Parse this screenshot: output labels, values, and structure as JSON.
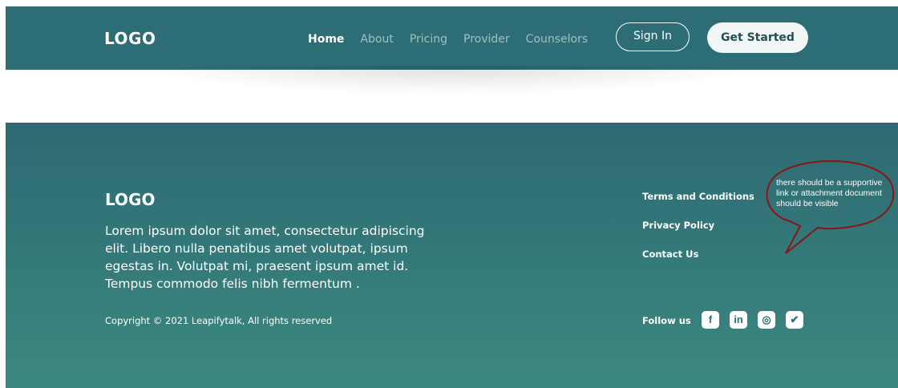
{
  "header": {
    "logo": "LOGO",
    "nav": [
      {
        "label": "Home"
      },
      {
        "label": "About"
      },
      {
        "label": "Pricing"
      },
      {
        "label": "Provider"
      },
      {
        "label": "Counselors"
      }
    ],
    "sign_in": "Sign In",
    "get_started": "Get Started"
  },
  "footer": {
    "logo": "LOGO",
    "description": "Lorem ipsum dolor sit amet, consectetur adipiscing elit. Libero nulla penatibus amet volutpat, ipsum egestas in. Volutpat mi, praesent ipsum amet id. Tempus commodo felis nibh fermentum .",
    "copyright": "Copyright © 2021 Leapifytalk, All rights reserved",
    "links": [
      {
        "label": "Terms and Conditions"
      },
      {
        "label": "Privacy Policy"
      },
      {
        "label": "Contact Us"
      }
    ],
    "follow_label": "Follow us",
    "social": [
      {
        "icon": "facebook-icon",
        "glyph": "f"
      },
      {
        "icon": "linkedin-icon",
        "glyph": "in"
      },
      {
        "icon": "instagram-icon",
        "glyph": "◎"
      },
      {
        "icon": "twitter-icon",
        "glyph": "✔"
      }
    ]
  },
  "annotation": {
    "text": "there should be a supportive link or attachment document should be visible",
    "color": "#8b1414"
  },
  "colors": {
    "header_bg": "#2d6e76",
    "footer_top": "#2d6a73",
    "footer_bottom": "#3b8880"
  }
}
